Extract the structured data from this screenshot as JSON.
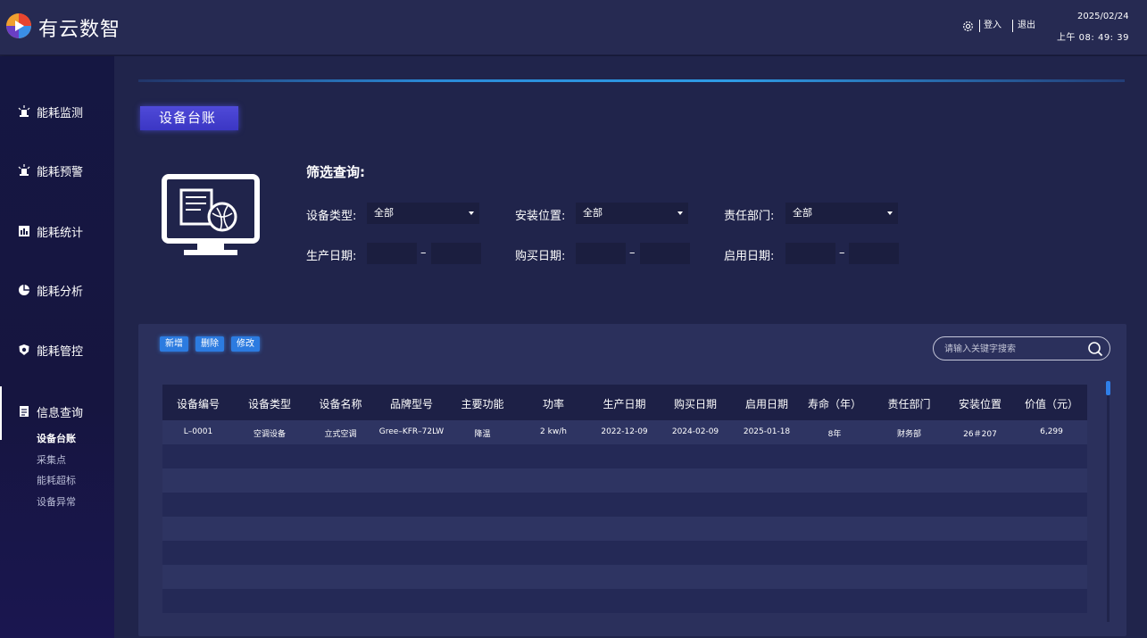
{
  "header": {
    "brand": "有云数智",
    "login": "登入",
    "logout": "退出",
    "date": "2025/02/24",
    "time": "上午 08: 49: 39"
  },
  "sidebar": {
    "items": [
      {
        "label": "能耗监测",
        "icon": "lamp-icon"
      },
      {
        "label": "能耗预警",
        "icon": "alarm-icon"
      },
      {
        "label": "能耗统计",
        "icon": "bar-chart-icon"
      },
      {
        "label": "能耗分析",
        "icon": "pie-chart-icon"
      },
      {
        "label": "能耗管控",
        "icon": "shield-icon"
      },
      {
        "label": "信息查询",
        "icon": "document-icon"
      }
    ],
    "subitems": [
      "设备台账",
      "采集点",
      "能耗超标",
      "设备异常"
    ]
  },
  "section": {
    "title": "设备台账"
  },
  "filter": {
    "title": "筛选查询:",
    "device_type_label": "设备类型:",
    "device_type_value": "全部",
    "location_label": "安装位置:",
    "location_value": "全部",
    "department_label": "责任部门:",
    "department_value": "全部",
    "production_date_label": "生产日期:",
    "purchase_date_label": "购买日期:",
    "start_date_label": "启用日期:",
    "dash": "–"
  },
  "toolbar": {
    "add": "新增",
    "delete": "删除",
    "edit": "修改"
  },
  "search": {
    "placeholder": "请输入关键字搜索"
  },
  "table": {
    "columns": [
      "设备编号",
      "设备类型",
      "设备名称",
      "品牌型号",
      "主要功能",
      "功率",
      "生产日期",
      "购买日期",
      "启用日期",
      "寿命（年）",
      "责任部门",
      "安装位置",
      "价值（元）"
    ],
    "rows": [
      [
        "L–0001",
        "空调设备",
        "立式空调",
        "Gree–KFR–72LW",
        "降温",
        "2 kw/h",
        "2022-12-09",
        "2024-02-09",
        "2025-01-18",
        "8年",
        "财务部",
        "26＃207",
        "6,299"
      ]
    ]
  }
}
